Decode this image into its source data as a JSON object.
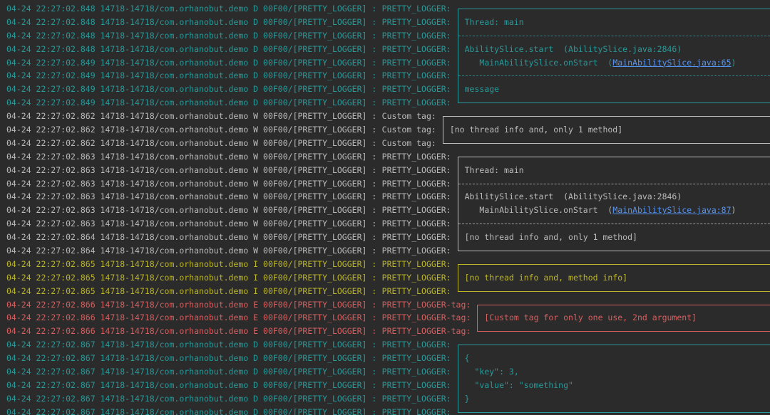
{
  "colors": {
    "background": "#2b2b2b",
    "debug": "#299999",
    "warn": "#bbbbbb",
    "info": "#bbb529",
    "error": "#d75f5f",
    "link": "#5694f2"
  },
  "lines": [
    {
      "prefix": "04-24 22:27:02.848 14718-14718/com.orhanobut.demo D 00F00/[PRETTY_LOGGER] :",
      "tag": "PRETTY_LOGGER:",
      "level": "D",
      "box": "top",
      "text": ""
    },
    {
      "prefix": "04-24 22:27:02.848 14718-14718/com.orhanobut.demo D 00F00/[PRETTY_LOGGER] :",
      "tag": "PRETTY_LOGGER:",
      "level": "D",
      "box": "mid",
      "text": "Thread: main"
    },
    {
      "prefix": "04-24 22:27:02.848 14718-14718/com.orhanobut.demo D 00F00/[PRETTY_LOGGER] :",
      "tag": "PRETTY_LOGGER:",
      "level": "D",
      "box": "sep",
      "text": ""
    },
    {
      "prefix": "04-24 22:27:02.848 14718-14718/com.orhanobut.demo D 00F00/[PRETTY_LOGGER] :",
      "tag": "PRETTY_LOGGER:",
      "level": "D",
      "box": "mid",
      "text": "AbilitySlice.start  (AbilitySlice.java:2846)"
    },
    {
      "prefix": "04-24 22:27:02.849 14718-14718/com.orhanobut.demo D 00F00/[PRETTY_LOGGER] :",
      "tag": "PRETTY_LOGGER:",
      "level": "D",
      "box": "mid",
      "text": "   MainAbilitySlice.onStart  (",
      "link": "MainAbilitySlice.java:65",
      "after": ")"
    },
    {
      "prefix": "04-24 22:27:02.849 14718-14718/com.orhanobut.demo D 00F00/[PRETTY_LOGGER] :",
      "tag": "PRETTY_LOGGER:",
      "level": "D",
      "box": "sep",
      "text": ""
    },
    {
      "prefix": "04-24 22:27:02.849 14718-14718/com.orhanobut.demo D 00F00/[PRETTY_LOGGER] :",
      "tag": "PRETTY_LOGGER:",
      "level": "D",
      "box": "mid",
      "text": "message"
    },
    {
      "prefix": "04-24 22:27:02.849 14718-14718/com.orhanobut.demo D 00F00/[PRETTY_LOGGER] :",
      "tag": "PRETTY_LOGGER:",
      "level": "D",
      "box": "bottom",
      "text": ""
    },
    {
      "prefix": "04-24 22:27:02.862 14718-14718/com.orhanobut.demo W 00F00/[PRETTY_LOGGER] :",
      "tag": "Custom tag:",
      "level": "W",
      "box": "top",
      "text": ""
    },
    {
      "prefix": "04-24 22:27:02.862 14718-14718/com.orhanobut.demo W 00F00/[PRETTY_LOGGER] :",
      "tag": "Custom tag:",
      "level": "W",
      "box": "mid",
      "text": "[no thread info and, only 1 method]"
    },
    {
      "prefix": "04-24 22:27:02.862 14718-14718/com.orhanobut.demo W 00F00/[PRETTY_LOGGER] :",
      "tag": "Custom tag:",
      "level": "W",
      "box": "bottom",
      "text": ""
    },
    {
      "prefix": "04-24 22:27:02.863 14718-14718/com.orhanobut.demo W 00F00/[PRETTY_LOGGER] :",
      "tag": "PRETTY_LOGGER:",
      "level": "W",
      "box": "top",
      "text": ""
    },
    {
      "prefix": "04-24 22:27:02.863 14718-14718/com.orhanobut.demo W 00F00/[PRETTY_LOGGER] :",
      "tag": "PRETTY_LOGGER:",
      "level": "W",
      "box": "mid",
      "text": "Thread: main"
    },
    {
      "prefix": "04-24 22:27:02.863 14718-14718/com.orhanobut.demo W 00F00/[PRETTY_LOGGER] :",
      "tag": "PRETTY_LOGGER:",
      "level": "W",
      "box": "sep",
      "text": ""
    },
    {
      "prefix": "04-24 22:27:02.863 14718-14718/com.orhanobut.demo W 00F00/[PRETTY_LOGGER] :",
      "tag": "PRETTY_LOGGER:",
      "level": "W",
      "box": "mid",
      "text": "AbilitySlice.start  (AbilitySlice.java:2846)"
    },
    {
      "prefix": "04-24 22:27:02.863 14718-14718/com.orhanobut.demo W 00F00/[PRETTY_LOGGER] :",
      "tag": "PRETTY_LOGGER:",
      "level": "W",
      "box": "mid",
      "text": "   MainAbilitySlice.onStart  (",
      "link": "MainAbilitySlice.java:87",
      "after": ")"
    },
    {
      "prefix": "04-24 22:27:02.863 14718-14718/com.orhanobut.demo W 00F00/[PRETTY_LOGGER] :",
      "tag": "PRETTY_LOGGER:",
      "level": "W",
      "box": "sep",
      "text": ""
    },
    {
      "prefix": "04-24 22:27:02.864 14718-14718/com.orhanobut.demo W 00F00/[PRETTY_LOGGER] :",
      "tag": "PRETTY_LOGGER:",
      "level": "W",
      "box": "mid",
      "text": "[no thread info and, only 1 method]"
    },
    {
      "prefix": "04-24 22:27:02.864 14718-14718/com.orhanobut.demo W 00F00/[PRETTY_LOGGER] :",
      "tag": "PRETTY_LOGGER:",
      "level": "W",
      "box": "bottom",
      "text": ""
    },
    {
      "prefix": "04-24 22:27:02.865 14718-14718/com.orhanobut.demo I 00F00/[PRETTY_LOGGER] :",
      "tag": "PRETTY_LOGGER:",
      "level": "I",
      "box": "top",
      "text": ""
    },
    {
      "prefix": "04-24 22:27:02.865 14718-14718/com.orhanobut.demo I 00F00/[PRETTY_LOGGER] :",
      "tag": "PRETTY_LOGGER:",
      "level": "I",
      "box": "mid",
      "text": "[no thread info and, method info]"
    },
    {
      "prefix": "04-24 22:27:02.865 14718-14718/com.orhanobut.demo I 00F00/[PRETTY_LOGGER] :",
      "tag": "PRETTY_LOGGER:",
      "level": "I",
      "box": "bottom",
      "text": ""
    },
    {
      "prefix": "04-24 22:27:02.866 14718-14718/com.orhanobut.demo E 00F00/[PRETTY_LOGGER] :",
      "tag": "PRETTY_LOGGER-tag:",
      "level": "E",
      "box": "top",
      "text": ""
    },
    {
      "prefix": "04-24 22:27:02.866 14718-14718/com.orhanobut.demo E 00F00/[PRETTY_LOGGER] :",
      "tag": "PRETTY_LOGGER-tag:",
      "level": "E",
      "box": "mid",
      "text": "[Custom tag for only one use, 2nd argument]"
    },
    {
      "prefix": "04-24 22:27:02.866 14718-14718/com.orhanobut.demo E 00F00/[PRETTY_LOGGER] :",
      "tag": "PRETTY_LOGGER-tag:",
      "level": "E",
      "box": "bottom",
      "text": ""
    },
    {
      "prefix": "04-24 22:27:02.867 14718-14718/com.orhanobut.demo D 00F00/[PRETTY_LOGGER] :",
      "tag": "PRETTY_LOGGER:",
      "level": "D",
      "box": "top",
      "text": ""
    },
    {
      "prefix": "04-24 22:27:02.867 14718-14718/com.orhanobut.demo D 00F00/[PRETTY_LOGGER] :",
      "tag": "PRETTY_LOGGER:",
      "level": "D",
      "box": "mid",
      "text": "{"
    },
    {
      "prefix": "04-24 22:27:02.867 14718-14718/com.orhanobut.demo D 00F00/[PRETTY_LOGGER] :",
      "tag": "PRETTY_LOGGER:",
      "level": "D",
      "box": "mid",
      "text": "  \"key\": 3,"
    },
    {
      "prefix": "04-24 22:27:02.867 14718-14718/com.orhanobut.demo D 00F00/[PRETTY_LOGGER] :",
      "tag": "PRETTY_LOGGER:",
      "level": "D",
      "box": "mid",
      "text": "  \"value\": \"something\""
    },
    {
      "prefix": "04-24 22:27:02.867 14718-14718/com.orhanobut.demo D 00F00/[PRETTY_LOGGER] :",
      "tag": "PRETTY_LOGGER:",
      "level": "D",
      "box": "mid",
      "text": "}"
    },
    {
      "prefix": "04-24 22:27:02.867 14718-14718/com.orhanobut.demo D 00F00/[PRETTY_LOGGER] :",
      "tag": "PRETTY_LOGGER:",
      "level": "D",
      "box": "bottom",
      "text": ""
    }
  ]
}
